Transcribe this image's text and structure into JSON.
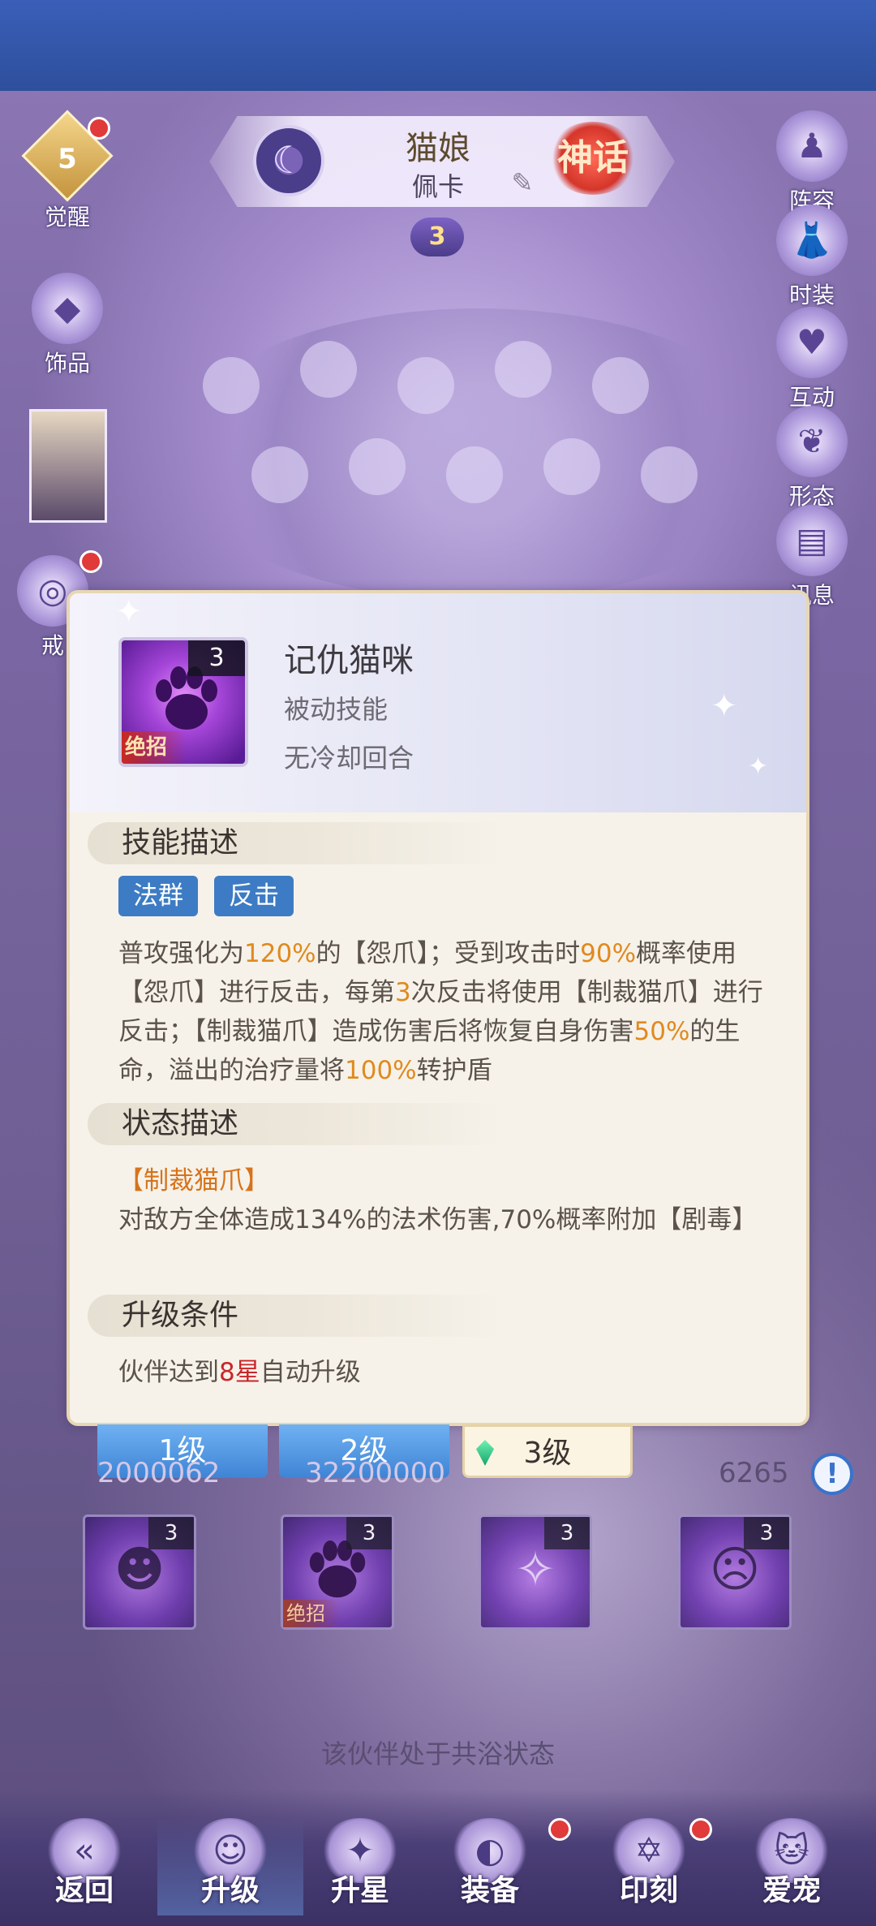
{
  "character": {
    "name": "猫娘",
    "subname": "佩卡",
    "rarity_badge": "神话",
    "stars": "3"
  },
  "left_menu": {
    "awaken_level": "5",
    "awaken_label": "觉醒",
    "accessory_label": "饰品",
    "ring_label": "戒"
  },
  "right_menu": {
    "lineup_label": "阵容",
    "costume_label": "时装",
    "interact_label": "互动",
    "form_label": "形态",
    "info_label": "讯息"
  },
  "skill_panel": {
    "icon_level": "3",
    "icon_tag": "绝招",
    "title": "记仇猫咪",
    "type": "被动技能",
    "cooldown": "无冷却回合",
    "section_desc": "技能描述",
    "tags": [
      "法群",
      "反击"
    ],
    "desc_parts": {
      "p1": "普攻强化为",
      "v1": "120%",
      "p2": "的【怨爪】；受到攻击时",
      "v2": "90%",
      "p3": "概率使用【怨爪】进行反击，每第",
      "v3": "3",
      "p4": "次反击将使用【制裁猫爪】进行反击；【制裁猫爪】造成伤害后将恢复自身伤害",
      "v4": "50%",
      "p5": "的生命，溢出的治疗量将",
      "v5": "100%",
      "p6": "转护盾"
    },
    "section_state": "状态描述",
    "state_name": "【制裁猫爪】",
    "state_text": "对敌方全体造成134%的法术伤害,70%概率附加【剧毒】",
    "section_upgrade": "升级条件",
    "upgrade_parts": {
      "p1": "伙伴达到",
      "v1": "8星",
      "p2": "自动升级"
    }
  },
  "level_tabs": [
    "1级",
    "2级",
    "3级"
  ],
  "stats": {
    "left_value": "2000062",
    "mid_value": "32200000",
    "right_value": "6265"
  },
  "skill_slots": [
    {
      "level": "3",
      "tag": ""
    },
    {
      "level": "3",
      "tag": "绝招"
    },
    {
      "level": "3",
      "tag": ""
    },
    {
      "level": "3",
      "tag": ""
    }
  ],
  "bath_status": "该伙伴处于共浴状态",
  "bottom_nav": [
    "返回",
    "升级",
    "升星",
    "装备",
    "印刻",
    "爱宠"
  ],
  "colors": {
    "tag_blue": "#3d7cc4",
    "highlight_orange": "#e08a1e",
    "highlight_red": "#c8272a",
    "panel_bg": "#f6f2ea"
  }
}
